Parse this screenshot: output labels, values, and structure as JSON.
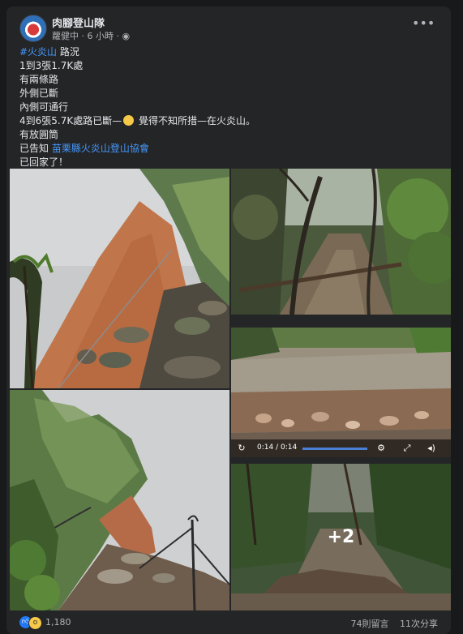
{
  "post": {
    "page_name": "肉腳登山隊",
    "meta": "蘿健中 · 6 小時 · ",
    "globe_icon": "globe-icon",
    "more_icon": "more-horizontal-icon"
  },
  "content": {
    "hashtag": "#火炎山",
    "line1_rest": " 路況",
    "line2": "1到3張1.7K處",
    "line3": "有兩條路",
    "line4": "外側已斷",
    "line5": "內側可通行",
    "line6_a": "4到6張5.7K處路已斷—",
    "line6_b": " 覺得不知所措—在火炎山。",
    "line7": "有放圓筒",
    "line8_a": "已告知 ",
    "line8_link": "苗栗縣火炎山登山協會",
    "line9": "已回家了！"
  },
  "video": {
    "time": "0:14 / 0:14"
  },
  "photos_more": "+2",
  "footer": {
    "reaction_count": "1,180",
    "comments": "74則留言",
    "shares": "11次分享"
  },
  "colors": {
    "link": "#4599ff",
    "card": "#242526",
    "background": "#18191a"
  }
}
